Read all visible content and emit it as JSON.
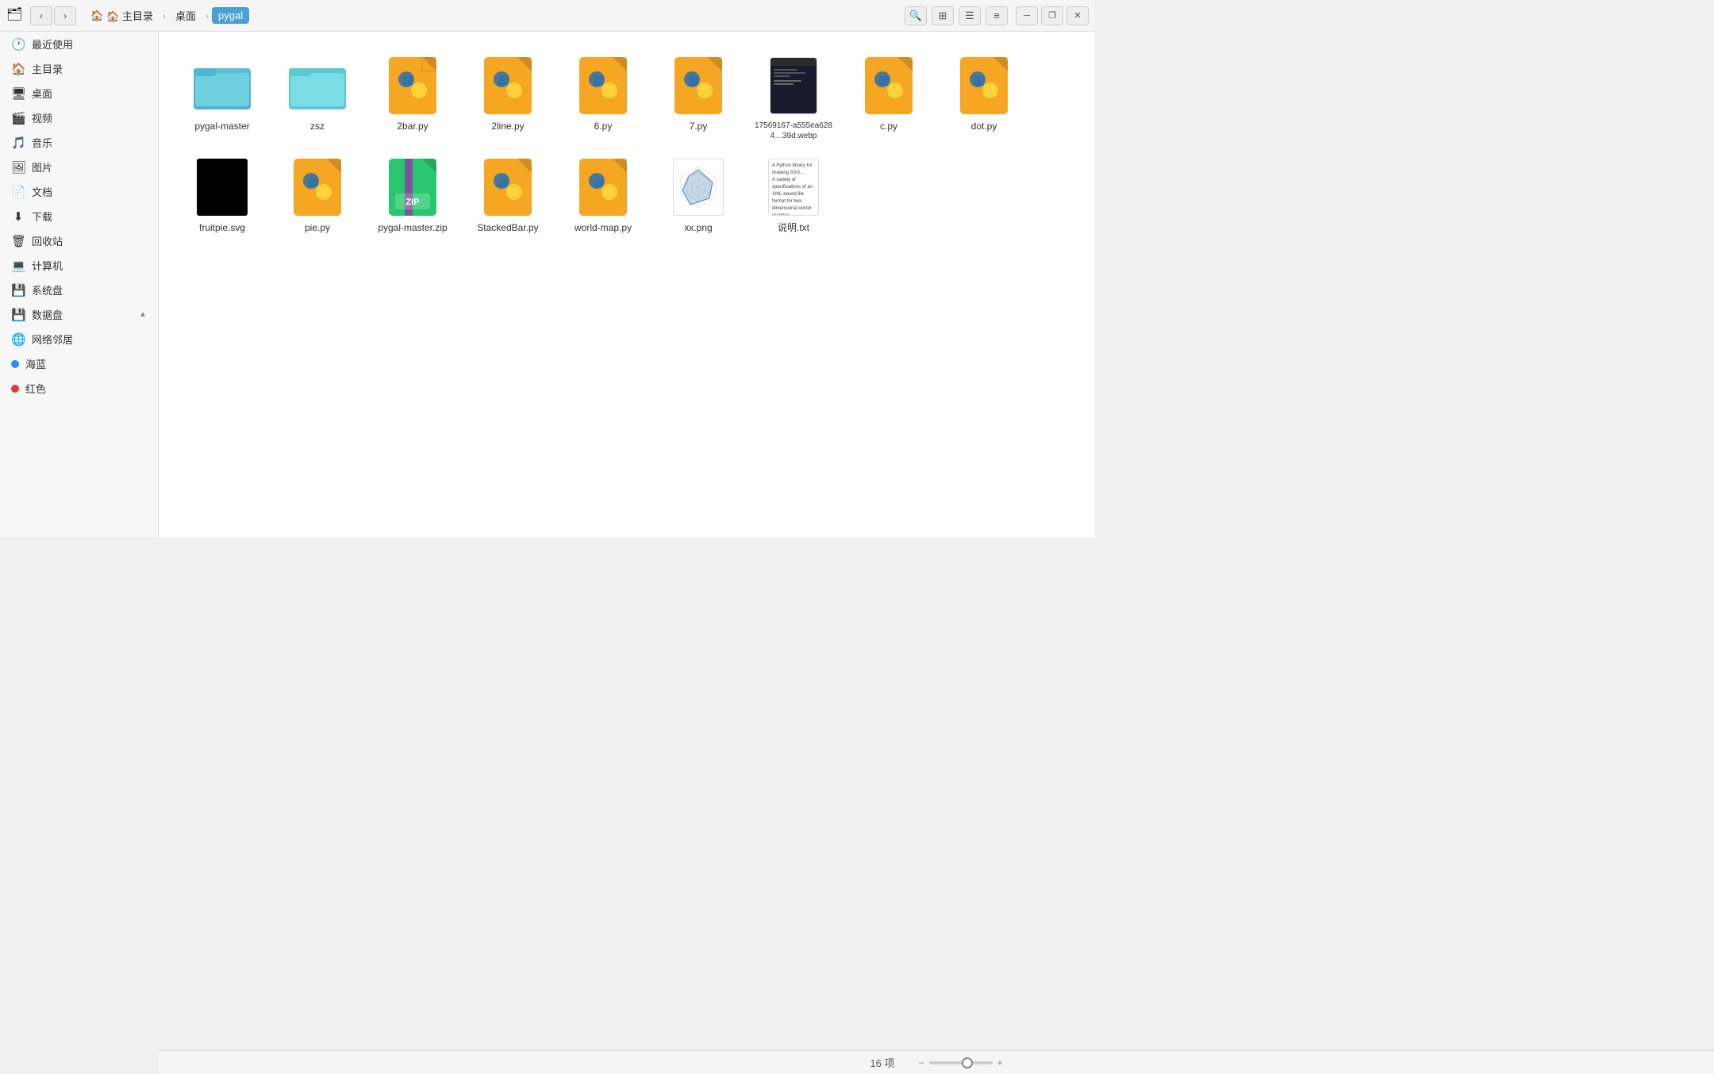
{
  "titlebar": {
    "app_icon": "🗂",
    "nav_back": "‹",
    "nav_forward": "›",
    "breadcrumb": [
      {
        "label": "🏠 主目录",
        "active": false
      },
      {
        "label": "桌面",
        "active": false
      },
      {
        "label": "pygal",
        "active": true
      }
    ],
    "search_icon": "🔍",
    "view_grid_icon": "⊞",
    "view_list_icon": "☰",
    "menu_icon": "≡",
    "minimize": "─",
    "restore": "❐",
    "close": "✕"
  },
  "sidebar": {
    "items": [
      {
        "label": "最近使用",
        "icon": "🕐",
        "type": "nav"
      },
      {
        "label": "主目录",
        "icon": "🏠",
        "type": "nav"
      },
      {
        "label": "桌面",
        "icon": "🖥",
        "type": "nav"
      },
      {
        "label": "视频",
        "icon": "🎬",
        "type": "nav"
      },
      {
        "label": "音乐",
        "icon": "🎵",
        "type": "nav"
      },
      {
        "label": "图片",
        "icon": "🖼",
        "type": "nav"
      },
      {
        "label": "文档",
        "icon": "📄",
        "type": "nav"
      },
      {
        "label": "下载",
        "icon": "⬇",
        "type": "nav"
      },
      {
        "label": "回收站",
        "icon": "🗑",
        "type": "nav"
      },
      {
        "label": "计算机",
        "icon": "💻",
        "type": "nav"
      },
      {
        "label": "系统盘",
        "icon": "💾",
        "type": "nav"
      },
      {
        "label": "数据盘",
        "icon": "💾",
        "type": "nav",
        "expand": "▲"
      },
      {
        "label": "网络邻居",
        "icon": "🌐",
        "type": "nav"
      },
      {
        "label": "海蓝",
        "dot_color": "#1e90ff",
        "type": "tag"
      },
      {
        "label": "红色",
        "dot_color": "#e53935",
        "type": "tag"
      }
    ]
  },
  "files": [
    {
      "name": "pygal-master",
      "type": "folder",
      "color": "#4eb8d4"
    },
    {
      "name": "zsz",
      "type": "folder",
      "color": "#5cc8d0"
    },
    {
      "name": "2bar.py",
      "type": "py",
      "color": "#f5a623"
    },
    {
      "name": "2line.py",
      "type": "py",
      "color": "#f5a623"
    },
    {
      "name": "6.py",
      "type": "py",
      "color": "#f5a623"
    },
    {
      "name": "7.py",
      "type": "py",
      "color": "#f5a623"
    },
    {
      "name": "17569167-a555ea6284…39d.webp",
      "type": "webp"
    },
    {
      "name": "c.py",
      "type": "py",
      "color": "#f5a623"
    },
    {
      "name": "dot.py",
      "type": "py",
      "color": "#f5a623"
    },
    {
      "name": "fruitpie.svg",
      "type": "svg_black"
    },
    {
      "name": "pie.py",
      "type": "py",
      "color": "#f5a623"
    },
    {
      "name": "pygal-master.zip",
      "type": "zip"
    },
    {
      "name": "StackedBar.py",
      "type": "py",
      "color": "#f5a623"
    },
    {
      "name": "world-map.py",
      "type": "py",
      "color": "#f5a623"
    },
    {
      "name": "xx.png",
      "type": "img_chart"
    },
    {
      "name": "说明.txt",
      "type": "txt"
    }
  ],
  "statusbar": {
    "count_label": "16 项"
  }
}
